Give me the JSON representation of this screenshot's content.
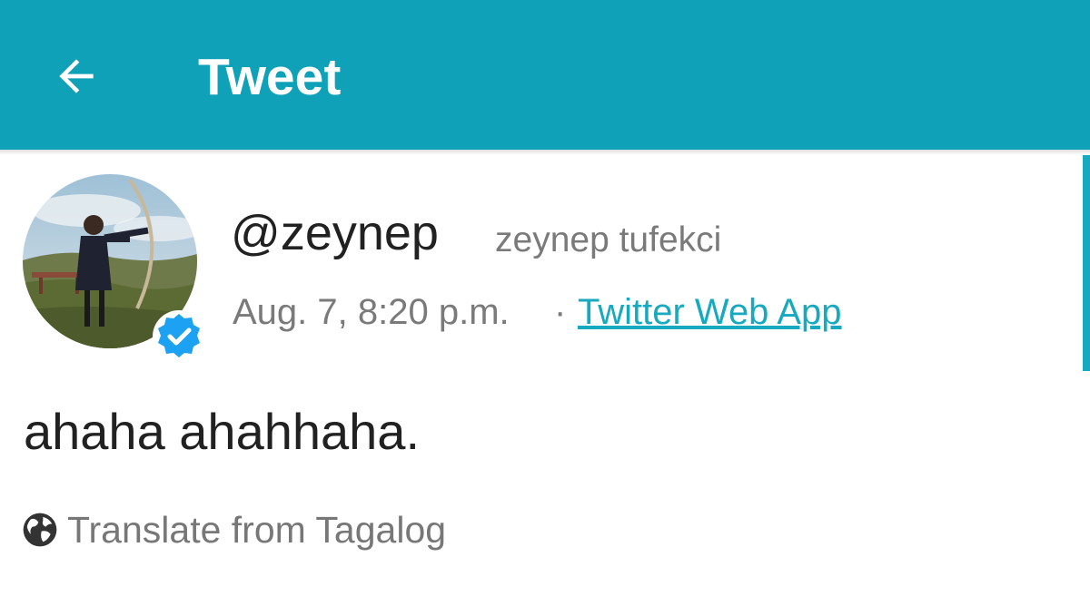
{
  "header": {
    "title": "Tweet",
    "back_icon": "arrow-left-icon",
    "background_color": "#0fa1b7"
  },
  "tweet": {
    "avatar_icon": "profile-photo",
    "verified_icon": "verified-badge-icon",
    "handle": "@zeynep",
    "display_name": "zeynep tufekci",
    "timestamp": "Aug. 7, 8:20 p.m.",
    "separator": "·",
    "client": "Twitter Web App",
    "text": "ahaha ahahhaha.",
    "translate_label": "Translate from Tagalog",
    "translate_icon": "globe-icon"
  },
  "colors": {
    "accent": "#17a9c0",
    "primary_text": "#212121",
    "secondary_text": "#7a7a7a"
  }
}
